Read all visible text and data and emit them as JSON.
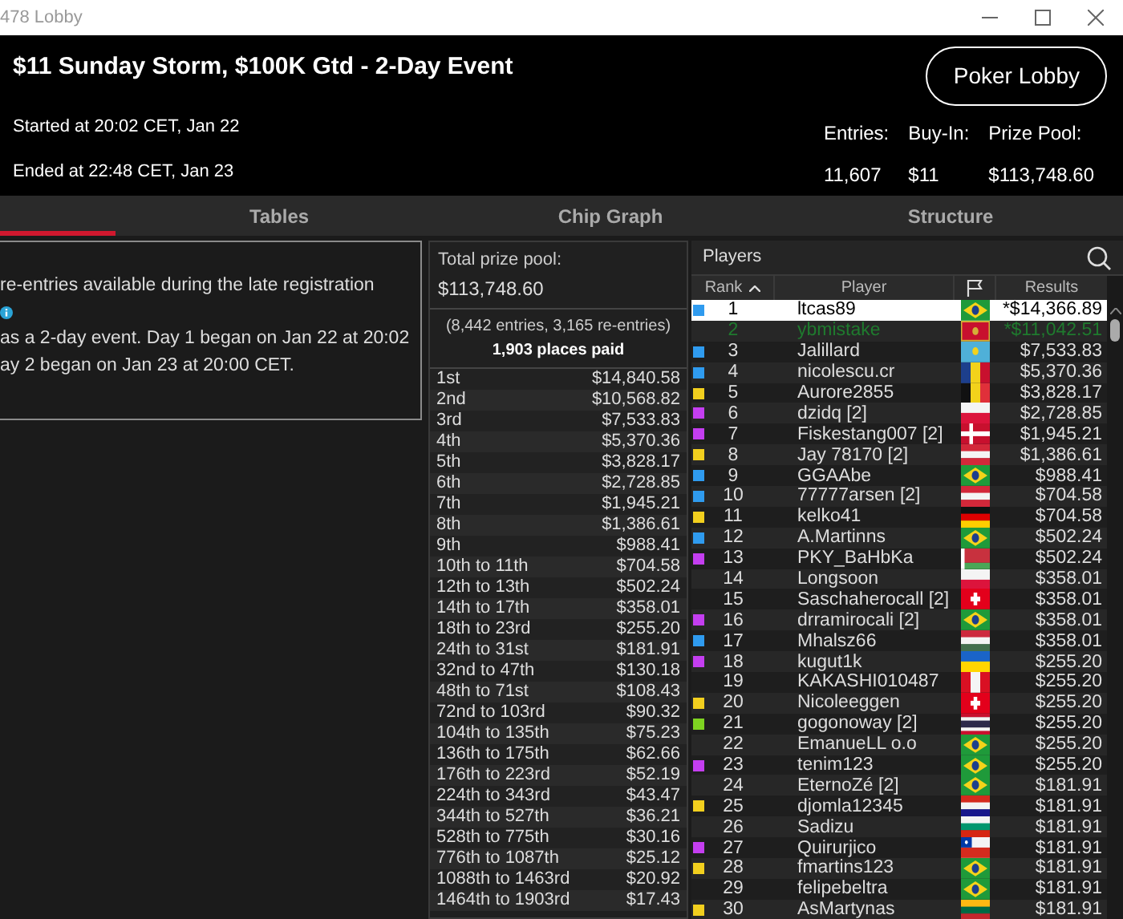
{
  "window": {
    "title": "478 Lobby"
  },
  "header": {
    "title": "$11 Sunday Storm, $100K Gtd - 2-Day Event",
    "started": "Started at 20:02 CET, Jan 22",
    "ended": "Ended at 22:48 CET, Jan 23",
    "lobby_button": "Poker Lobby",
    "stats": [
      {
        "label": "Entries:",
        "value": "11,607"
      },
      {
        "label": "Buy-In:",
        "value": "$11"
      },
      {
        "label": "Prize Pool:",
        "value": "$113,748.60"
      }
    ]
  },
  "tabs": [
    {
      "label": "Tables",
      "selected": false
    },
    {
      "label": "Chip Graph",
      "selected": false
    },
    {
      "label": "Structure",
      "selected": false
    }
  ],
  "info": {
    "lines": [
      {
        "kind": "text",
        "text": "re-entries available during the late registration"
      },
      {
        "kind": "icon"
      },
      {
        "kind": "text",
        "text": "as a 2-day event. Day 1 began on Jan 22 at 20:02"
      },
      {
        "kind": "text",
        "text": "ay 2 began on Jan 23 at 20:00 CET."
      }
    ]
  },
  "prizes": {
    "total_label": "Total prize pool:",
    "total": "$113,748.60",
    "entries": "(8,442 entries, 3,165 re-entries)",
    "places_paid": "1,903 places paid",
    "rows": [
      [
        "1st",
        "$14,840.58"
      ],
      [
        "2nd",
        "$10,568.82"
      ],
      [
        "3rd",
        "$7,533.83"
      ],
      [
        "4th",
        "$5,370.36"
      ],
      [
        "5th",
        "$3,828.17"
      ],
      [
        "6th",
        "$2,728.85"
      ],
      [
        "7th",
        "$1,945.21"
      ],
      [
        "8th",
        "$1,386.61"
      ],
      [
        "9th",
        "$988.41"
      ],
      [
        "10th to 11th",
        "$704.58"
      ],
      [
        "12th to 13th",
        "$502.24"
      ],
      [
        "14th to 17th",
        "$358.01"
      ],
      [
        "18th to 23rd",
        "$255.20"
      ],
      [
        "24th to 31st",
        "$181.91"
      ],
      [
        "32nd to 47th",
        "$130.18"
      ],
      [
        "48th to 71st",
        "$108.43"
      ],
      [
        "72nd to 103rd",
        "$90.32"
      ],
      [
        "104th to 135th",
        "$75.23"
      ],
      [
        "136th to 175th",
        "$62.66"
      ],
      [
        "176th to 223rd",
        "$52.19"
      ],
      [
        "224th to 343rd",
        "$43.47"
      ],
      [
        "344th to 527th",
        "$36.21"
      ],
      [
        "528th to 775th",
        "$30.16"
      ],
      [
        "776th to 1087th",
        "$25.12"
      ],
      [
        "1088th to 1463rd",
        "$20.92"
      ],
      [
        "1464th to 1903rd",
        "$17.43"
      ]
    ]
  },
  "players": {
    "title": "Players",
    "columns": [
      "Rank",
      "Player",
      "Results"
    ],
    "rows": [
      {
        "rank": "1",
        "player": "ltcas89",
        "kind": "br",
        "result": "*$14,366.89",
        "color": "#2f9bef",
        "selected": true,
        "own": false
      },
      {
        "rank": "2",
        "player": "ybmistake",
        "kind": "me",
        "result": "*$11,042.51",
        "selected": false,
        "own": true
      },
      {
        "rank": "3",
        "player": "Jalillard",
        "kind": "kz",
        "result": "$7,533.83",
        "color": "#2f9bef",
        "selected": false,
        "own": false
      },
      {
        "rank": "4",
        "player": "nicolescu.cr",
        "kind": "ro",
        "result": "$5,370.36",
        "color": "#2f9bef",
        "selected": false,
        "own": false
      },
      {
        "rank": "5",
        "player": "Aurore2855",
        "kind": "be",
        "result": "$3,828.17",
        "color": "#f2cf1e",
        "selected": false,
        "own": false
      },
      {
        "rank": "6",
        "player": "dzidq [2]",
        "kind": "pl",
        "result": "$2,728.85",
        "color": "#c43ef0",
        "selected": false,
        "own": false
      },
      {
        "rank": "7",
        "player": "Fiskestang007 [2]",
        "kind": "dk",
        "result": "$1,945.21",
        "color": "#c43ef0",
        "selected": false,
        "own": false
      },
      {
        "rank": "8",
        "player": "Jay 78170 [2]",
        "kind": "at",
        "result": "$1,386.61",
        "color": "#f2cf1e",
        "selected": false,
        "own": false
      },
      {
        "rank": "9",
        "player": "GGAAbe",
        "kind": "br",
        "result": "$988.41",
        "color": "#2f9bef",
        "selected": false,
        "own": false
      },
      {
        "rank": "10",
        "player": "77777arsen [2]",
        "kind": "at",
        "result": "$704.58",
        "color": "#2f9bef",
        "selected": false,
        "own": false
      },
      {
        "rank": "11",
        "player": "kelko41",
        "kind": "de",
        "result": "$704.58",
        "color": "#f2cf1e",
        "selected": false,
        "own": false
      },
      {
        "rank": "12",
        "player": "A.Martinns",
        "kind": "br",
        "result": "$502.24",
        "color": "#2f9bef",
        "selected": false,
        "own": false
      },
      {
        "rank": "13",
        "player": "PKY_BaHbKa",
        "kind": "by",
        "result": "$502.24",
        "color": "#c43ef0",
        "selected": false,
        "own": false
      },
      {
        "rank": "14",
        "player": "Longsoon",
        "kind": "pl",
        "result": "$358.01",
        "selected": false,
        "own": false
      },
      {
        "rank": "15",
        "player": "Saschaherocall [2]",
        "kind": "ch",
        "result": "$358.01",
        "selected": false,
        "own": false
      },
      {
        "rank": "16",
        "player": "drramirocali [2]",
        "kind": "br",
        "result": "$358.01",
        "color": "#c43ef0",
        "selected": false,
        "own": false
      },
      {
        "rank": "17",
        "player": "Mhalsz66",
        "kind": "hu",
        "result": "$358.01",
        "color": "#2f9bef",
        "selected": false,
        "own": false
      },
      {
        "rank": "18",
        "player": "kugut1k",
        "kind": "ua",
        "result": "$255.20",
        "color": "#c43ef0",
        "selected": false,
        "own": false
      },
      {
        "rank": "19",
        "player": "KAKASHI010487",
        "kind": "pe",
        "result": "$255.20",
        "selected": false,
        "own": false
      },
      {
        "rank": "20",
        "player": "Nicoleeggen",
        "kind": "ch",
        "result": "$255.20",
        "color": "#f2cf1e",
        "selected": false,
        "own": false
      },
      {
        "rank": "21",
        "player": "gogonoway [2]",
        "kind": "th",
        "result": "$255.20",
        "color": "#7ed321",
        "selected": false,
        "own": false
      },
      {
        "rank": "22",
        "player": "EmanueLL o.o",
        "kind": "br",
        "result": "$255.20",
        "selected": false,
        "own": false
      },
      {
        "rank": "23",
        "player": "tenim123",
        "kind": "br",
        "result": "$255.20",
        "color": "#c43ef0",
        "selected": false,
        "own": false
      },
      {
        "rank": "24",
        "player": "EternoZé [2]",
        "kind": "br",
        "result": "$181.91",
        "selected": false,
        "own": false
      },
      {
        "rank": "25",
        "player": "djomla12345",
        "kind": "hr",
        "result": "$181.91",
        "color": "#f2cf1e",
        "selected": false,
        "own": false
      },
      {
        "rank": "26",
        "player": "Sadizu",
        "kind": "bg",
        "result": "$181.91",
        "selected": false,
        "own": false
      },
      {
        "rank": "27",
        "player": "Quirurjico",
        "kind": "cl",
        "result": "$181.91",
        "color": "#c43ef0",
        "selected": false,
        "own": false
      },
      {
        "rank": "28",
        "player": "fmartins123",
        "kind": "br",
        "result": "$181.91",
        "color": "#f2cf1e",
        "selected": false,
        "own": false
      },
      {
        "rank": "29",
        "player": "felipebeltra",
        "kind": "br",
        "result": "$181.91",
        "selected": false,
        "own": false
      },
      {
        "rank": "30",
        "player": "AsMartynas",
        "kind": "lt",
        "result": "$181.91",
        "color": "#f2cf1e",
        "selected": false,
        "own": false
      }
    ]
  }
}
